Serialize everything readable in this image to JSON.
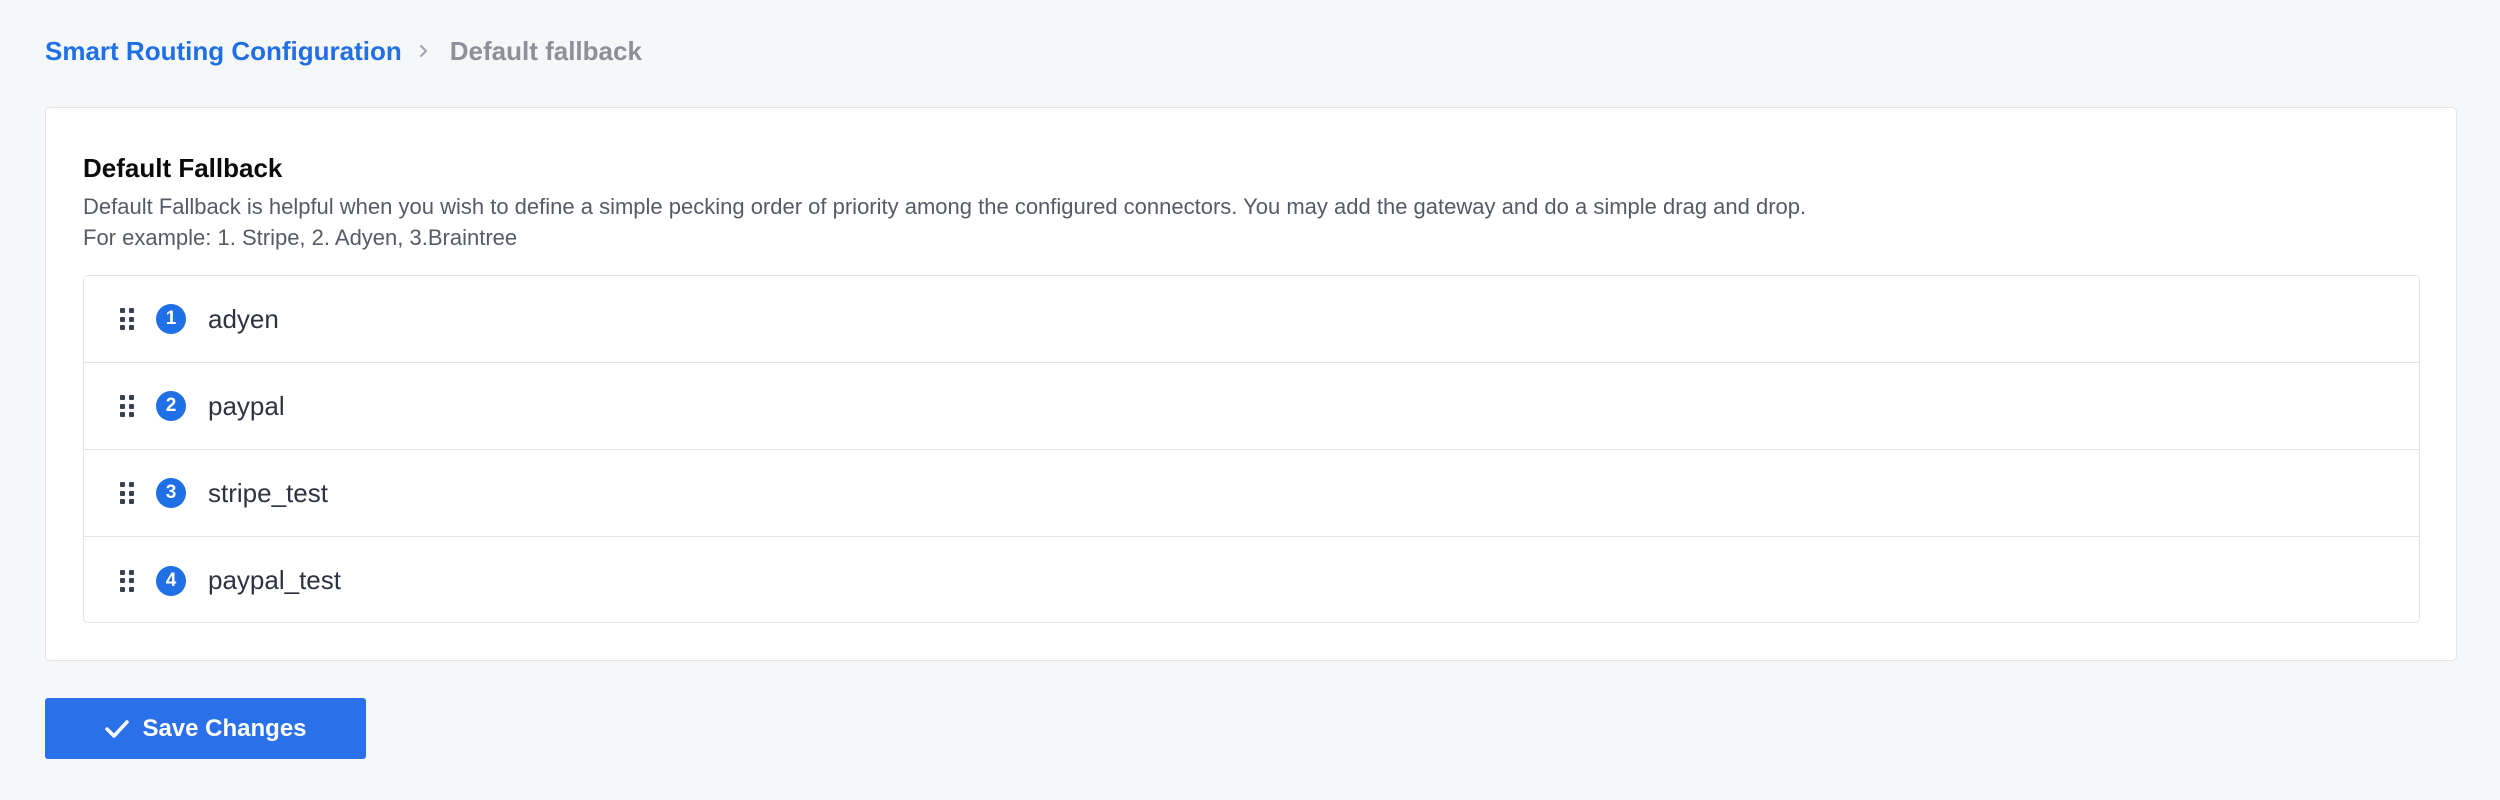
{
  "breadcrumb": {
    "parent": "Smart Routing Configuration",
    "current": "Default fallback",
    "separator_icon": "chevron-right-icon"
  },
  "card": {
    "title": "Default Fallback",
    "description_line1": "Default Fallback is helpful when you wish to define a simple pecking order of priority among the configured connectors. You may add the gateway and do a simple drag and drop.",
    "description_line2": "For example: 1. Stripe, 2. Adyen, 3.Braintree"
  },
  "connectors": [
    {
      "priority": "1",
      "name": "adyen"
    },
    {
      "priority": "2",
      "name": "paypal"
    },
    {
      "priority": "3",
      "name": "stripe_test"
    },
    {
      "priority": "4",
      "name": "paypal_test"
    }
  ],
  "actions": {
    "save_label": "Save Changes",
    "save_icon": "check-icon"
  },
  "colors": {
    "accent": "#1f6fe5",
    "background": "#f6f7f9",
    "card": "#ffffff",
    "border": "#e2e4e8"
  }
}
